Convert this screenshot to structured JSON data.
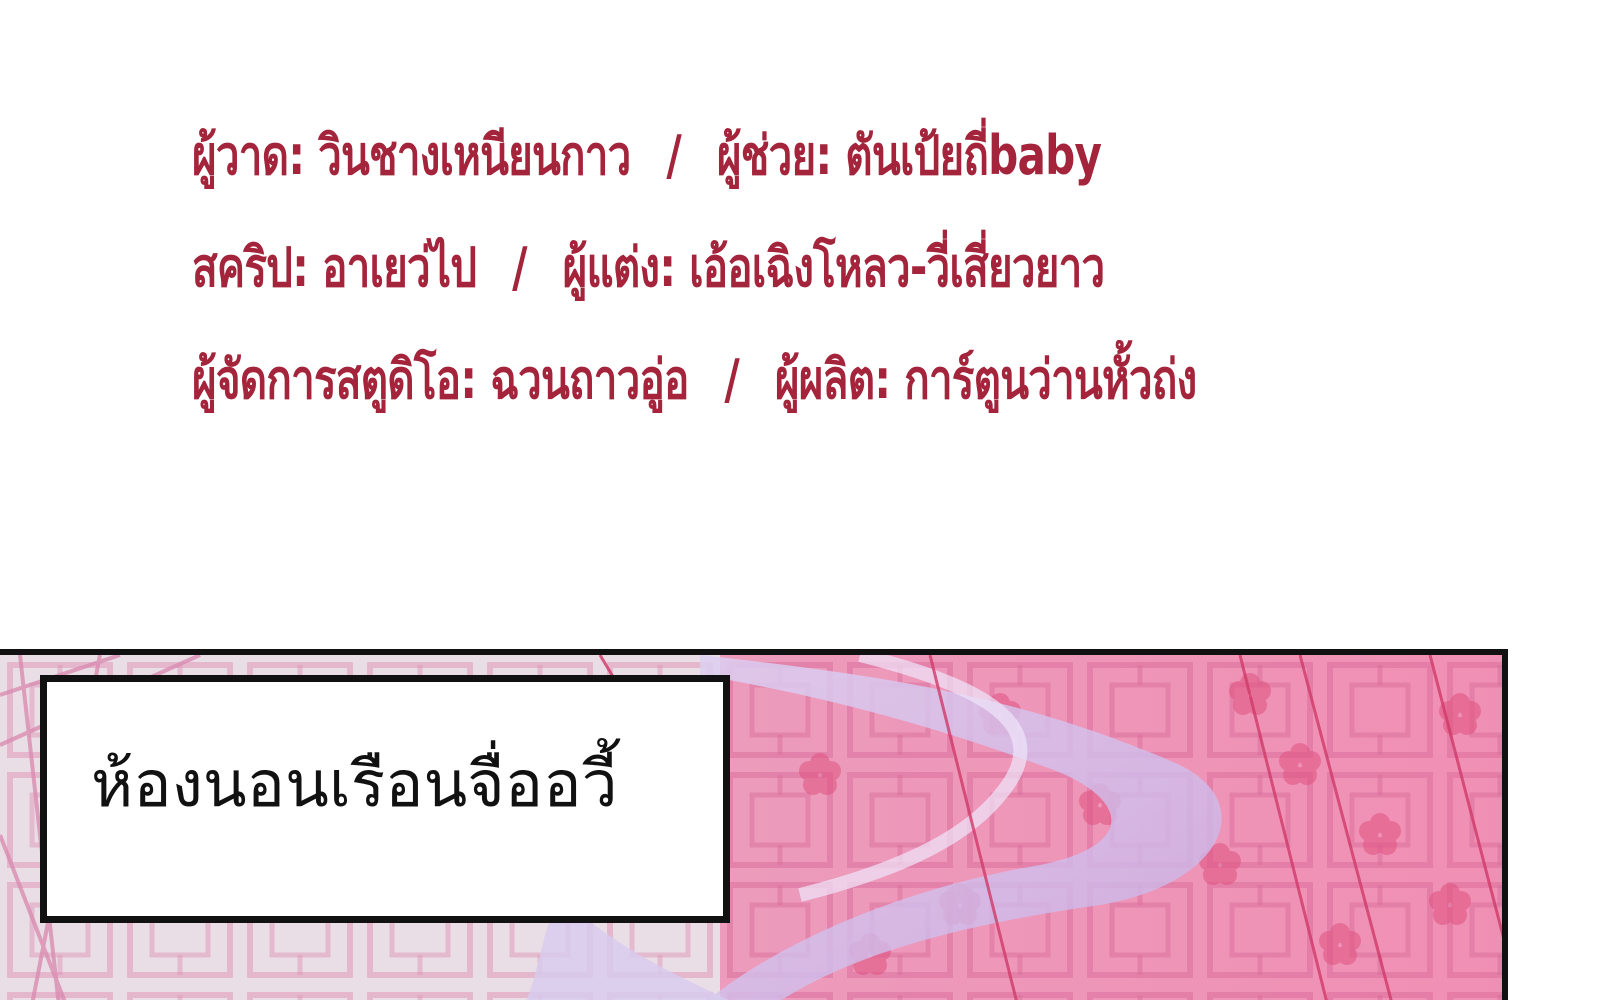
{
  "credits": {
    "line1": {
      "left": "ผู้วาด: วินชางเหนียนกาว",
      "separator": "/",
      "right": "ผู้ช่วย: ตันเป้ยถี่baby"
    },
    "line2": {
      "left": "สคริป: อาเยว่ไป",
      "separator": "/",
      "right": "ผู้แต่ง: เอ้อเฉิงโหลว-วี่เสี่ยวยาว"
    },
    "line3": {
      "left": "ผู้จัดการสตูดิโอ: ฉวนถาวอู่อ",
      "separator": "/",
      "right": "ผู้ผลิต: การ์ตูนว่านหั้วถ่ง"
    },
    "color": "#a3243b"
  },
  "panel": {
    "caption": "ห้องนอนเรือนจื่ออวี้",
    "colors": {
      "pink": "#e88ab0",
      "lavender": "#c9b6e8",
      "blossom": "#e0527f",
      "border": "#111111"
    }
  }
}
